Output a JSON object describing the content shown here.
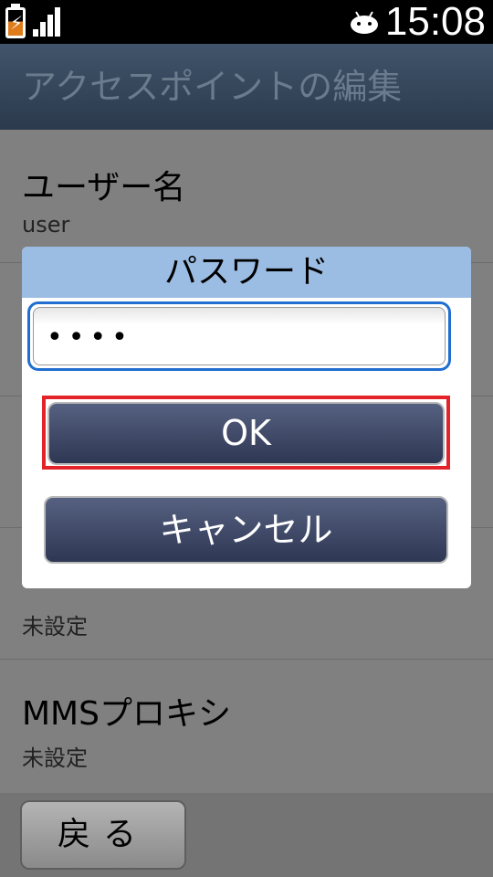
{
  "status_bar": {
    "time": "15:08",
    "icons": [
      "battery-charging-icon",
      "signal-icon",
      "android-icon"
    ]
  },
  "header": {
    "title": "アクセスポイントの編集"
  },
  "settings": {
    "username": {
      "label": "ユーザー名",
      "value": "user"
    },
    "row4_value": "未設定",
    "mms_proxy": {
      "label": "MMSプロキシ",
      "value": "未設定"
    }
  },
  "dialog": {
    "title": "パスワード",
    "password_value": "••••",
    "ok_label": "OK",
    "cancel_label": "キャンセル",
    "highlight_color": "#e32229"
  },
  "bottom_bar": {
    "back_label": "戻る"
  },
  "colors": {
    "header_bg": "#2b3a4c",
    "dialog_title_bg": "#9cbde3",
    "button_bg": "#2e3854",
    "focus_border": "#1f6ed0"
  }
}
